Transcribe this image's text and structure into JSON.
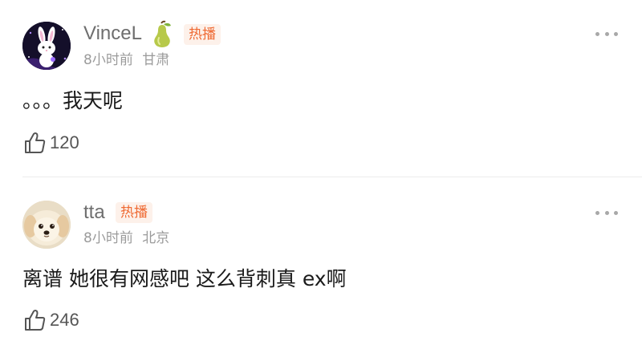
{
  "colors": {
    "username": "#6e6e6e",
    "tag_text": "#ef6a33",
    "tag_bg": "#fdf1ea",
    "meta": "#9b9b9b",
    "content": "#1a1a1a",
    "divider": "#ececec"
  },
  "comments": [
    {
      "username": "VinceL",
      "badge_icon": "pear-icon",
      "tag": "热播",
      "time": "8小时前",
      "location": "甘肃",
      "content": "。。。我天呢",
      "likes": "120",
      "avatar_icon": "bunny-avatar"
    },
    {
      "username": "tta",
      "tag": "热播",
      "time": "8小时前",
      "location": "北京",
      "content": "离谱 她很有网感吧 这么背刺真 ex啊",
      "likes": "246",
      "avatar_icon": "puppy-avatar"
    }
  ]
}
